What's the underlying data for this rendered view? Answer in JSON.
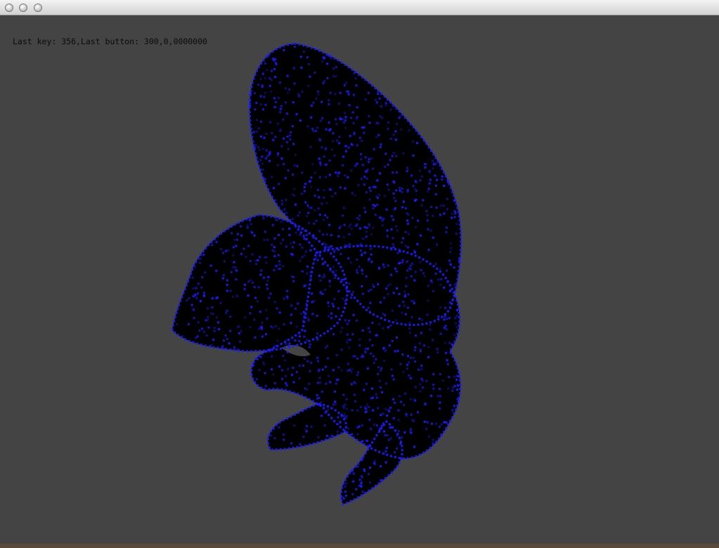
{
  "window": {
    "title": "",
    "controls": [
      "close",
      "minimize",
      "zoom"
    ]
  },
  "status": {
    "text": "Last key: 356,Last button: 300,0,0000000"
  },
  "scene": {
    "background_color": "#444444",
    "model": "squirrel point-cloud mesh",
    "fill_color": "#000000",
    "point_color": "#1a1aff"
  }
}
